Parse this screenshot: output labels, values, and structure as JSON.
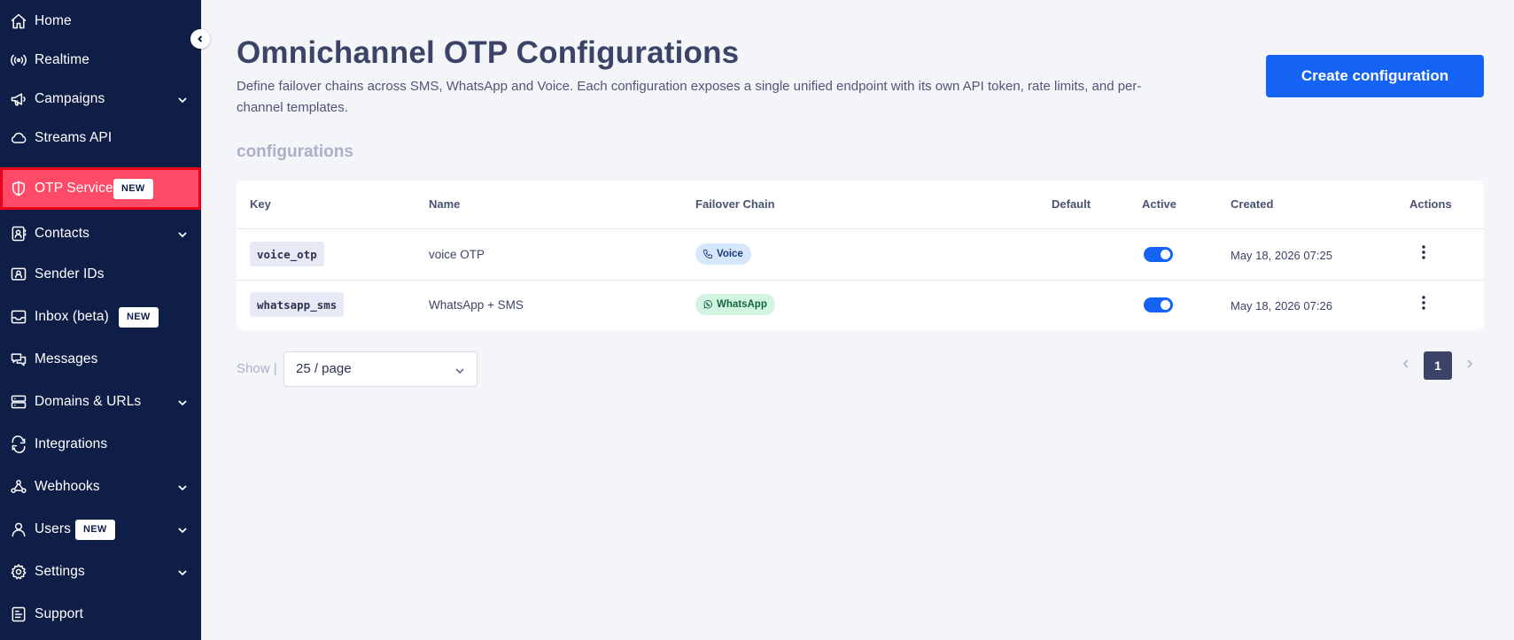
{
  "sidebar": {
    "items": [
      {
        "label": "Home",
        "icon": "home-icon"
      },
      {
        "label": "Realtime",
        "icon": "broadcast-icon"
      },
      {
        "label": "Campaigns",
        "icon": "megaphone-icon"
      },
      {
        "label": "Streams API",
        "icon": "cloud-icon"
      },
      {
        "label": "OTP Service",
        "icon": "shield-icon",
        "badge": "NEW"
      },
      {
        "label": "Contacts",
        "icon": "contacts-icon"
      },
      {
        "label": "Sender IDs",
        "icon": "id-card-icon"
      },
      {
        "label": "Inbox (beta)",
        "icon": "inbox-icon",
        "badge": "NEW"
      },
      {
        "label": "Messages",
        "icon": "chat-icon"
      },
      {
        "label": "Domains & URLs",
        "icon": "server-icon"
      },
      {
        "label": "Integrations",
        "icon": "swap-icon"
      },
      {
        "label": "Webhooks",
        "icon": "webhook-icon"
      },
      {
        "label": "Users",
        "icon": "user-icon",
        "badge": "NEW"
      },
      {
        "label": "Settings",
        "icon": "gear-icon"
      },
      {
        "label": "Support",
        "icon": "support-icon"
      }
    ],
    "active_item": "OTP Service"
  },
  "header": {
    "title": "Omnichannel OTP Configurations",
    "description": "Define failover chains across SMS, WhatsApp and Voice. Each configuration exposes a single unified endpoint with its own API token, rate limits, and per-channel templates.",
    "create_button": "Create configuration"
  },
  "section_title": "configurations",
  "table": {
    "columns": {
      "key": "Key",
      "name": "Name",
      "failover": "Failover Chain",
      "default": "Default",
      "active": "Active",
      "created": "Created",
      "actions": "Actions"
    },
    "rows": [
      {
        "key": "voice_otp",
        "name": "voice OTP",
        "chain": "Voice",
        "chain_icon": "phone-icon",
        "active": true,
        "created": "May 18, 2026 07:25"
      },
      {
        "key": "whatsapp_sms",
        "name": "WhatsApp + SMS",
        "chain": "WhatsApp",
        "chain_icon": "whatsapp-icon",
        "active": true,
        "created": "May 18, 2026 07:26"
      }
    ]
  },
  "pagination": {
    "show_label": "Show |",
    "page_size": "25 / page",
    "current_page": "1"
  },
  "colors": {
    "sidebar_bg": "#0f1e47",
    "active_item_bg": "#ff4b68",
    "accent": "#1463f5",
    "title": "#3b4467"
  }
}
